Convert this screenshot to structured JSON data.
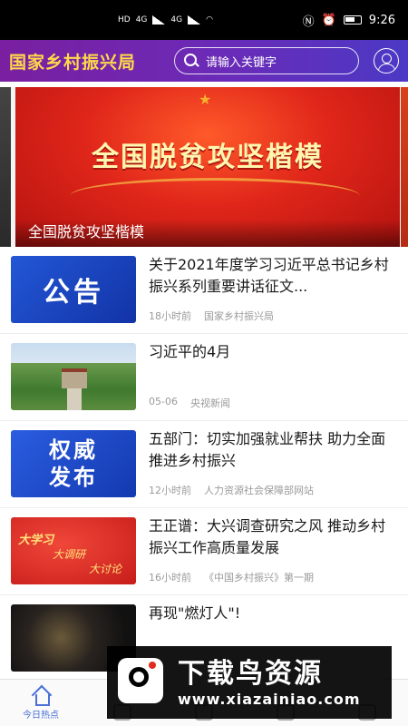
{
  "status_bar": {
    "left_labels": [
      "HD",
      "4G",
      "4G"
    ],
    "time": "9:26"
  },
  "header": {
    "title": "国家乡村振兴局",
    "search_placeholder": "请输入关键字"
  },
  "banner": {
    "headline": "全国脱贫攻坚楷模",
    "caption": "全国脱贫攻坚楷模"
  },
  "news": [
    {
      "thumb_text": "公告",
      "title": "关于2021年度学习习近平总书记乡村振兴系列重要讲话征文...",
      "time": "18小时前",
      "source": "国家乡村振兴局"
    },
    {
      "thumb_text": "",
      "title": "习近平的4月",
      "time": "05-06",
      "source": "央视新闻"
    },
    {
      "thumb_text": "权威发布",
      "title": "五部门：切实加强就业帮扶 助力全面推进乡村振兴",
      "time": "12小时前",
      "source": "人力资源社会保障部网站"
    },
    {
      "thumb_text": "大学习 大调研 大讨论",
      "thumb_lines": [
        "大学习",
        "大调研",
        "大讨论"
      ],
      "title": "王正谱：大兴调查研究之风 推动乡村振兴工作高质量发展",
      "time": "16小时前",
      "source": "《中国乡村振兴》第一期"
    },
    {
      "thumb_text": "",
      "title": "再现\"燃灯人\"!",
      "time": "",
      "source": ""
    }
  ],
  "bottom_nav": {
    "active_label": "今日热点"
  },
  "watermark": {
    "title": "下载鸟资源",
    "url": "www.xiazainiao.com"
  },
  "colors": {
    "header_gradient_start": "#7a1fa0",
    "header_gradient_end": "#4b39c5",
    "title_yellow": "#ffd84a",
    "active_nav": "#4a6fd6"
  }
}
